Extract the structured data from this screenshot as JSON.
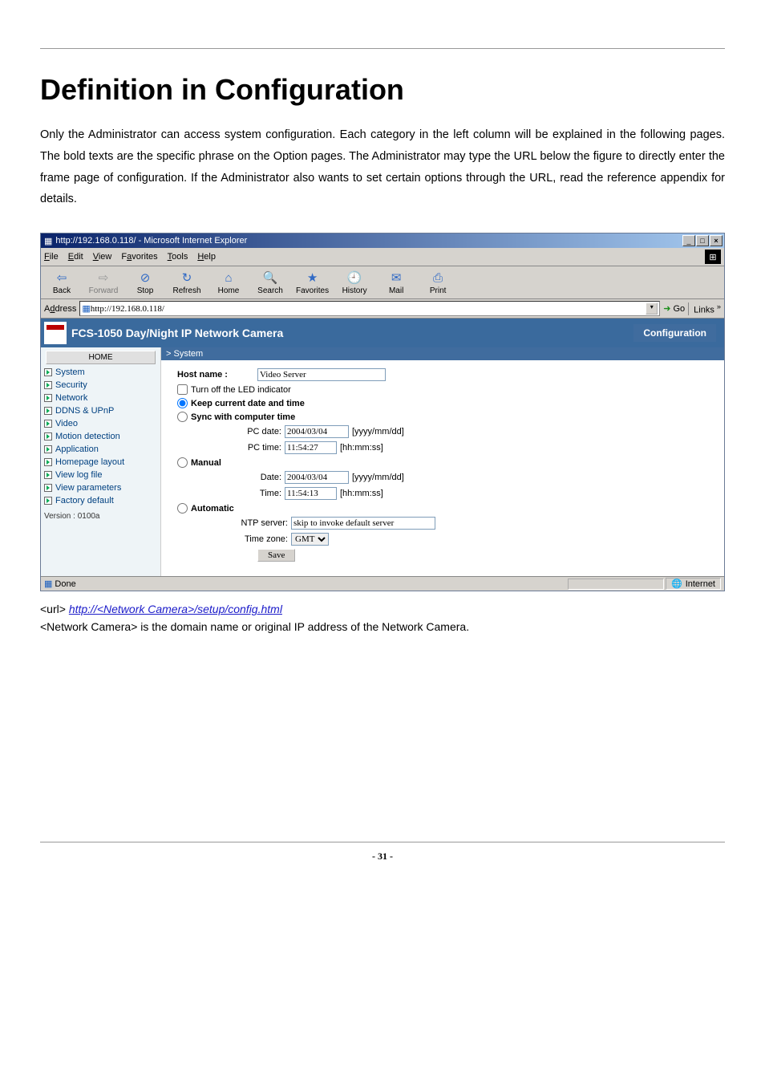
{
  "page_title": "Definition in Configuration",
  "intro_text": "Only the Administrator can access system configuration. Each category in the left column will be explained in the following pages. The bold texts are the specific phrase on the Option pages. The Administrator may type the URL below the figure to directly enter the frame page of configuration. If the Administrator also wants to set certain options through the URL, read the reference appendix for details.",
  "browser": {
    "window_title": "http://192.168.0.118/ - Microsoft Internet Explorer",
    "menus": {
      "file": "File",
      "edit": "Edit",
      "view": "View",
      "favorites": "Favorites",
      "tools": "Tools",
      "help": "Help"
    },
    "toolbar": {
      "back": "Back",
      "forward": "Forward",
      "stop": "Stop",
      "refresh": "Refresh",
      "home": "Home",
      "search": "Search",
      "favorites": "Favorites",
      "history": "History",
      "mail": "Mail",
      "print": "Print"
    },
    "address_label": "Address",
    "address_value": "http://192.168.0.118/",
    "go_label": "Go",
    "links_label": "Links",
    "status_done": "Done",
    "status_zone": "Internet"
  },
  "header": {
    "product": "FCS-1050  Day/Night IP Network Camera",
    "config_tab": "Configuration"
  },
  "sidebar": {
    "home": "HOME",
    "items": [
      {
        "label": "System"
      },
      {
        "label": "Security"
      },
      {
        "label": "Network"
      },
      {
        "label": "DDNS & UPnP"
      },
      {
        "label": "Video"
      },
      {
        "label": "Motion detection"
      },
      {
        "label": "Application"
      },
      {
        "label": "Homepage layout"
      },
      {
        "label": "View log file"
      },
      {
        "label": "View parameters"
      },
      {
        "label": "Factory default"
      }
    ],
    "version": "Version : 0100a"
  },
  "form": {
    "breadcrumb": "> System",
    "host_label": "Host name :",
    "host_value": "Video Server",
    "led_label": "Turn off the LED indicator",
    "keep_label": "Keep current date and time",
    "sync_label": "Sync with computer time",
    "pc_date_label": "PC date:",
    "pc_date_value": "2004/03/04",
    "pc_date_hint": "[yyyy/mm/dd]",
    "pc_time_label": "PC time:",
    "pc_time_value": "11:54:27",
    "pc_time_hint": "[hh:mm:ss]",
    "manual_label": "Manual",
    "m_date_label": "Date:",
    "m_date_value": "2004/03/04",
    "m_date_hint": "[yyyy/mm/dd]",
    "m_time_label": "Time:",
    "m_time_value": "11:54:13",
    "m_time_hint": "[hh:mm:ss]",
    "auto_label": "Automatic",
    "ntp_label": "NTP server:",
    "ntp_value": "skip to invoke default server",
    "tz_label": "Time zone:",
    "tz_value": "GMT",
    "save": "Save"
  },
  "under": {
    "url_prefix": "<url> ",
    "url_link": "http://<Network Camera>/setup/config.html",
    "desc": "<Network Camera> is the domain name or original IP address of the Network Camera."
  },
  "page_number": "- 31 -"
}
